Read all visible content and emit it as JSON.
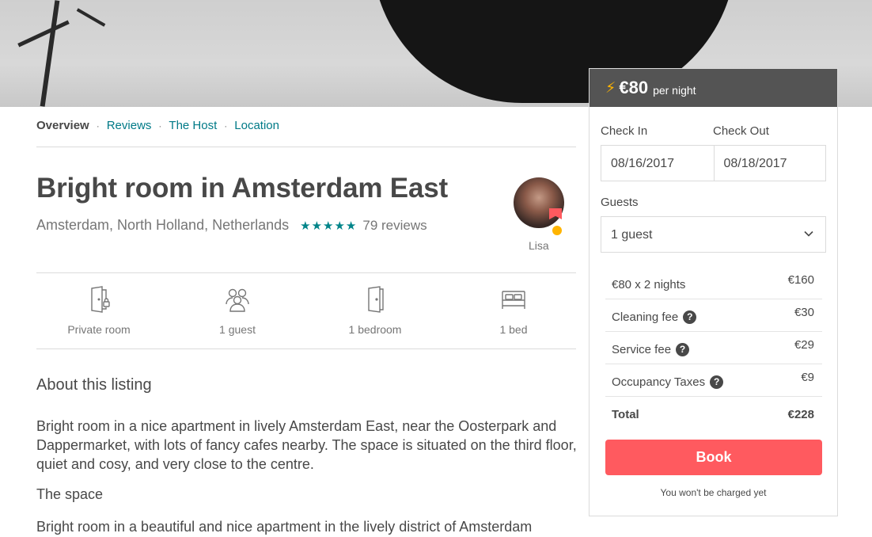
{
  "nav": {
    "items": [
      {
        "label": "Overview"
      },
      {
        "label": "Reviews"
      },
      {
        "label": "The Host"
      },
      {
        "label": "Location"
      }
    ],
    "separator": "·"
  },
  "listing": {
    "title": "Bright room in Amsterdam East",
    "location": "Amsterdam, North Holland, Netherlands",
    "stars": "★★★★★",
    "rating": 5,
    "reviews": "79 reviews",
    "host_name": "Lisa"
  },
  "amenities": [
    {
      "icon": "private-room-icon",
      "label": "Private room"
    },
    {
      "icon": "guests-icon",
      "label": "1 guest"
    },
    {
      "icon": "door-icon",
      "label": "1 bedroom"
    },
    {
      "icon": "bed-icon",
      "label": "1 bed"
    }
  ],
  "about": {
    "heading": "About this listing",
    "text": "Bright room in a nice apartment in lively Amsterdam East, near the Oosterpark and Dappermarket, with lots of fancy cafes nearby. The space is situated on the third floor, quiet and cosy, and very close to the centre.",
    "space_heading": "The space",
    "space_text": "Bright room in a beautiful and nice apartment in the lively district of Amsterdam"
  },
  "booking": {
    "price": "€80",
    "per_night": "per night",
    "check_in_label": "Check In",
    "check_out_label": "Check Out",
    "check_in": "08/16/2017",
    "check_out": "08/18/2017",
    "guests_label": "Guests",
    "guests": "1 guest",
    "lines": [
      {
        "label": "€80 x 2 nights",
        "amount": "€160"
      },
      {
        "label": "Cleaning fee",
        "amount": "€30"
      },
      {
        "label": "Service fee",
        "amount": "€29"
      },
      {
        "label": "Occupancy Taxes",
        "amount": "€9"
      }
    ],
    "total_label": "Total",
    "total": "€228",
    "help_glyph": "?",
    "book_label": "Book",
    "note": "You won't be charged yet"
  },
  "colors": {
    "accent": "#ff5a5f",
    "link": "#007a87",
    "stars": "#008489",
    "instant": "#ffb400"
  }
}
